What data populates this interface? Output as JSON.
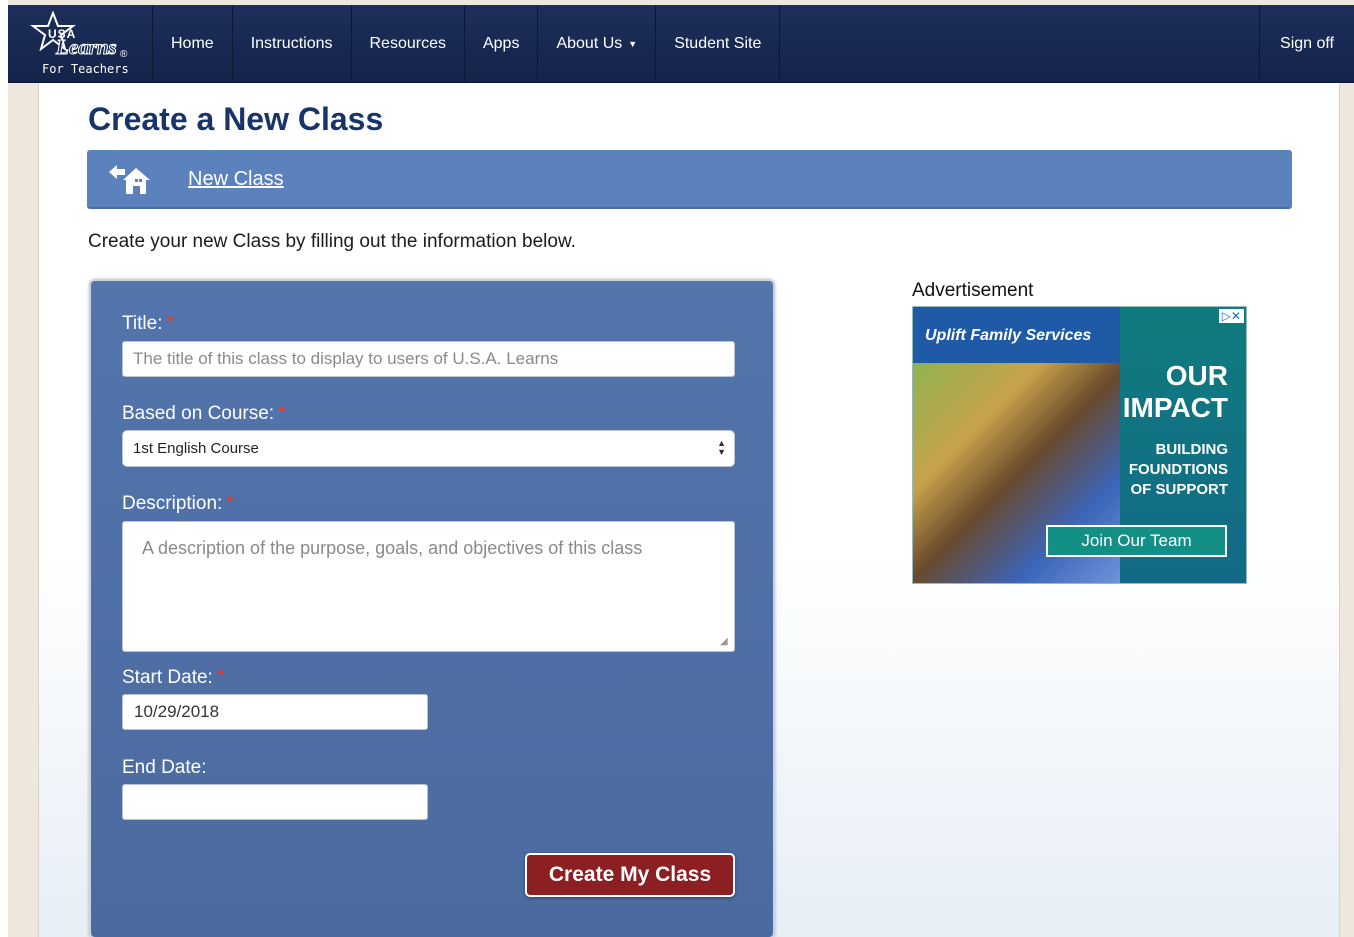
{
  "nav": {
    "logo": {
      "usa": "USA",
      "learns": "Learns",
      "reg": "®",
      "tagline": "For Teachers"
    },
    "items": [
      "Home",
      "Instructions",
      "Resources",
      "Apps",
      "About Us",
      "Student Site"
    ],
    "about_caret": "▼",
    "sign_off": "Sign off"
  },
  "page": {
    "title": "Create a New Class",
    "breadcrumb": "New Class",
    "intro": "Create your new Class by filling out the information below."
  },
  "form": {
    "required_mark": "*",
    "title_label": "Title:",
    "title_placeholder": "The title of this class to display to users of U.S.A. Learns",
    "course_label": "Based on Course:",
    "course_value": "1st English Course",
    "description_label": "Description:",
    "description_placeholder": "A description of the purpose, goals, and objectives of this class",
    "start_label": "Start Date:",
    "start_value": "10/29/2018",
    "end_label": "End Date:",
    "end_value": "",
    "submit_label": "Create My Class"
  },
  "ad": {
    "label": "Advertisement",
    "brand": "Uplift Family Services",
    "headline_1": "OUR",
    "headline_2": "IMPACT",
    "sub_1": "BUILDING",
    "sub_2": "FOUNDTIONS",
    "sub_3": "OF SUPPORT",
    "cta": "Join Our Team",
    "adchoice": "▷✕"
  },
  "colors": {
    "navbar": "#1d2f5a",
    "title": "#17356b",
    "panel": "#4f70a6",
    "button": "#8b1f22",
    "required": "#e23a2e"
  }
}
